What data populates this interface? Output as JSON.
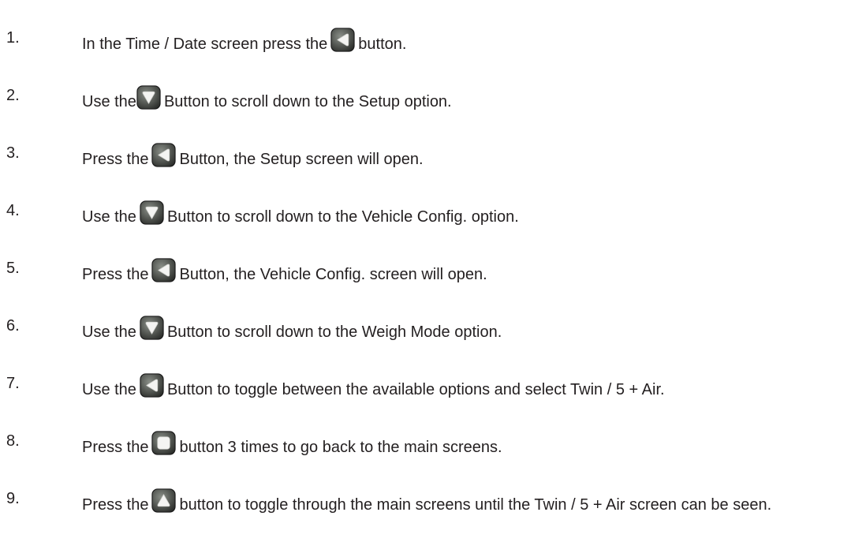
{
  "steps": [
    {
      "num": "1.",
      "before": "In the Time / Date screen press the",
      "icon": "left-arrow-button-icon",
      "after": "button."
    },
    {
      "num": "2.",
      "before": "Use the",
      "icon": "down-arrow-button-icon",
      "after": "Button to scroll down to the Setup option."
    },
    {
      "num": "3.",
      "before": "Press the",
      "icon": "left-arrow-button-icon",
      "after": "Button, the Setup screen will open."
    },
    {
      "num": "4.",
      "before": "Use the",
      "icon": "down-arrow-button-icon",
      "after": "Button to scroll down to the Vehicle Config. option."
    },
    {
      "num": "5.",
      "before": "Press the",
      "icon": "left-arrow-button-icon",
      "after": "Button, the Vehicle Config. screen will open."
    },
    {
      "num": "6.",
      "before": "Use the",
      "icon": "down-arrow-button-icon",
      "after": "Button to scroll down to the Weigh Mode option."
    },
    {
      "num": "7.",
      "before": "Use the",
      "icon": "left-arrow-button-icon",
      "after": "Button to toggle between the available options and select Twin / 5 + Air."
    },
    {
      "num": "8.",
      "before": "Press the",
      "icon": "square-button-icon",
      "after": "button 3 times to go back to the main screens."
    },
    {
      "num": "9.",
      "before": "Press the",
      "icon": "up-arrow-button-icon",
      "after": "button to toggle through the main screens until the Twin / 5 + Air screen can be seen."
    }
  ]
}
